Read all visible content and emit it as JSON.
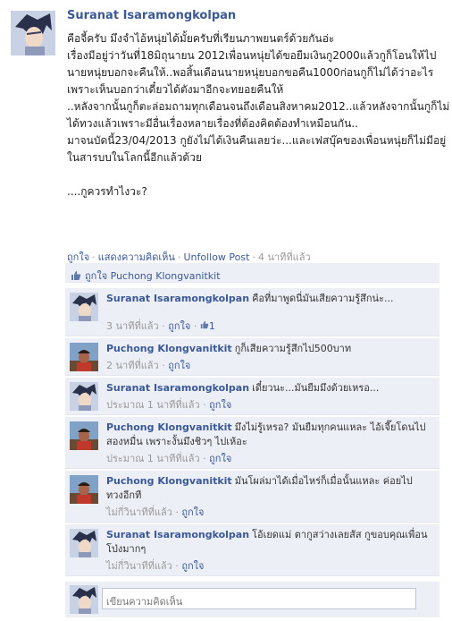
{
  "post": {
    "author": "Suranat Isaramongkolpan",
    "body": [
      "คือจี้ครับ มึงจำไอ้หนุ่ยได้มั้ยครับที่เรียนภาพยนตร์ด้วยกันอ่ะ",
      "เรื่องมีอยู่ว่าวันที่18มิถุนายน 2012เพื่อนหนุ่ยได้ขอยืมเงินกู2000แล้วกูก็โอนให้ไป",
      "นายหนุ่ยบอกจะคืนให้..พอสิ้นเดือนนายหนุ่ยบอกขอคืน1000ก่อนกูก็ไม่ได้ว่าอะไรเพราะเห็นบอกว่าเดี๋ยวได้ตังมาอีกจะทยอยคืนให้",
      "..หลังจากนั้นกูก็ตะล่อมถามทุกเดือนจนถึงเดือนสิงหาคม2012..แล้วหลังจากนั้นกูก็ไม่ได้ทวงแล้วเพราะมีอื่นเรื่องหลายเรื่องที่ต้องคิดต้องทำเหมือนกัน..",
      "มาจนบัดนี้23/04/2013 กูยังไม่ได้เงินคืนเลยว่ะ...และเฟสบุ๊คของเพื่อนหนุ่ยก็ไม่มีอยู่ในสารบบในโลกนี้อีกแล้วด้วย",
      "",
      "....กูควรทำไงวะ?"
    ],
    "actions": {
      "like": "ถูกใจ",
      "comment": "แสดงความคิดเห็น",
      "unfollow": "Unfollow Post",
      "time": "4 นาทีที่แล้ว"
    }
  },
  "likes": {
    "label": "ถูกใจ",
    "name": "Puchong Klongvanitkit"
  },
  "comments": [
    {
      "author": "Suranat Isaramongkolpan",
      "text": "คือที่มาพูดนี่มันเสียความรู้สึกน่ะ...",
      "time": "3 นาทีที่แล้ว",
      "like": "ถูกใจ",
      "like_count": "1",
      "avatar": "suranat"
    },
    {
      "author": "Puchong Klongvanitkit",
      "text": "กูก็เสียความรู้สึกไป500บาท",
      "time": "2 นาทีที่แล้ว",
      "like": "ถูกใจ",
      "avatar": "puchong"
    },
    {
      "author": "Suranat Isaramongkolpan",
      "text": "เดี๋ยวนะ...มันยืมมึงด้วยเหรอ...",
      "time": "ประมาณ 1 นาทีที่แล้ว",
      "like": "ถูกใจ",
      "avatar": "suranat"
    },
    {
      "author": "Puchong Klongvanitkit",
      "text": "มึงไม่รู้เหรอ? มันยืมทุกคนแหละ ไอ้เจี๊ยโดนไปสองหมื่น เพราะงั้นมึงชิวๆ ไปเห้อะ",
      "time": "ประมาณ 1 นาทีที่แล้ว",
      "like": "ถูกใจ",
      "avatar": "puchong"
    },
    {
      "author": "Puchong Klongvanitkit",
      "text": "มันโผล่มาได้เมื่อไหร่ก็เมื่อนั้นแหละ ค่อยไปทวงอีกที",
      "time": "ไม่กี่วินาทีที่แล้ว",
      "like": "ถูกใจ",
      "avatar": "puchong"
    },
    {
      "author": "Suranat Isaramongkolpan",
      "text": "โอ้เยดแม่ ตากูสว่างเลยสัส กูขอบคุณเพื่อนโป่งมากๆ",
      "time": "ไม่กี่วินาทีที่แล้ว",
      "like": "ถูกใจ",
      "avatar": "suranat"
    }
  ],
  "compose": {
    "placeholder": "เขียนความคิดเห็น"
  }
}
